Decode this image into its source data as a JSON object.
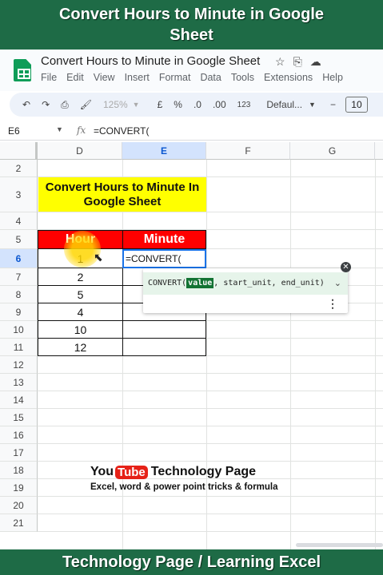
{
  "banner": {
    "top_line1": "Convert Hours to Minute in Google",
    "top_line2": "Sheet",
    "bottom": "Technology Page / Learning Excel"
  },
  "app": {
    "title": "Convert Hours to Minute in Google Sheet",
    "menus": [
      "File",
      "Edit",
      "View",
      "Insert",
      "Format",
      "Data",
      "Tools",
      "Extensions",
      "Help"
    ]
  },
  "toolbar": {
    "zoom": "125%",
    "currency": "£",
    "percent": "%",
    "dec_decrease": ".0",
    "dec_increase": ".00",
    "number_format": "123",
    "font_name": "Defaul...",
    "minus": "−",
    "font_size": "10"
  },
  "formula_bar": {
    "name_box": "E6",
    "fx": "fx",
    "formula": "=CONVERT("
  },
  "columns": [
    "D",
    "E",
    "F",
    "G"
  ],
  "selected_column": "E",
  "rows": [
    "2",
    "3",
    "4",
    "5",
    "6",
    "7",
    "8",
    "9",
    "10",
    "11",
    "12",
    "13",
    "14",
    "15",
    "16",
    "17",
    "18",
    "19",
    "20",
    "21"
  ],
  "selected_row": "6",
  "sheet": {
    "title_cell_line1": "Convert Hours to Minute In",
    "title_cell_line2": "Google Sheet",
    "header_hour": "Hour",
    "header_minute": "Minute",
    "hours": [
      "1",
      "2",
      "5",
      "4",
      "10",
      "12"
    ],
    "active_cell_text": "=CONVERT("
  },
  "autocomplete": {
    "func": "CONVERT(",
    "active_arg": "value",
    "rest_args": ", start_unit, end_unit)",
    "close_icon": "close-icon",
    "more_icon": "more-vert-icon"
  },
  "watermark": {
    "you": "You",
    "tube": "Tube",
    "brand": "Technology Page",
    "tagline": "Excel, word & power point tricks & formula"
  },
  "colors": {
    "banner": "#1e6b46",
    "title_fill": "#ffff00",
    "header_fill": "#ff0000",
    "selection": "#1a73e8"
  }
}
